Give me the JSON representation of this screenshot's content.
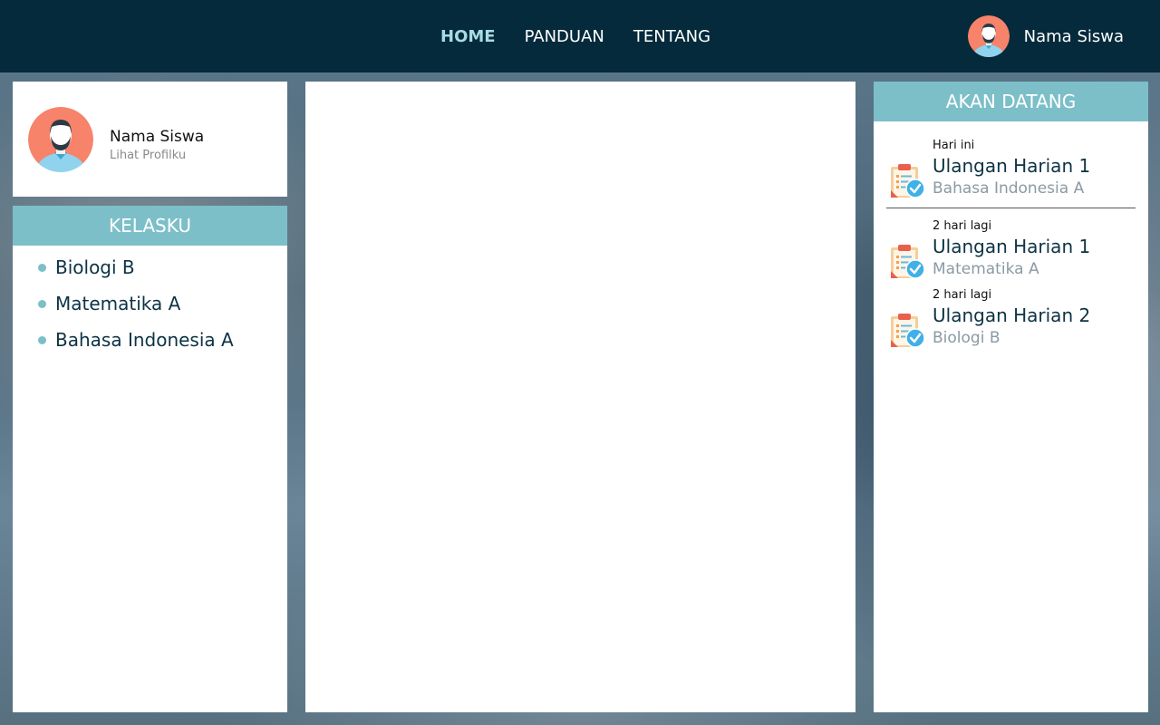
{
  "nav": {
    "links": [
      {
        "label": "HOME",
        "active": true
      },
      {
        "label": "PANDUAN",
        "active": false
      },
      {
        "label": "TENTANG",
        "active": false
      }
    ],
    "user_name": "Nama Siswa"
  },
  "profile": {
    "name": "Nama Siswa",
    "link_label": "Lihat Profilku"
  },
  "kelasku": {
    "title": "KELASKU",
    "items": [
      {
        "label": "Biologi B"
      },
      {
        "label": "Matematika A"
      },
      {
        "label": "Bahasa Indonesia A"
      }
    ]
  },
  "upcoming": {
    "title": "AKAN DATANG",
    "events": [
      {
        "when": "Hari ini",
        "title": "Ulangan Harian 1",
        "subject": "Bahasa Indonesia A"
      },
      {
        "when": "2 hari lagi",
        "title": "Ulangan Harian 1",
        "subject": "Matematika A"
      },
      {
        "when": "2 hari lagi",
        "title": "Ulangan Harian 2",
        "subject": "Biologi B"
      }
    ]
  },
  "colors": {
    "navbar": "#042a3c",
    "accent": "#7cbfc8",
    "active_link": "#a9dbe3",
    "avatar_bg": "#f7836a"
  },
  "icons": {
    "avatar": "person-avatar-icon",
    "exam": "clipboard-check-icon",
    "bullet": "bullet-dot-icon"
  }
}
